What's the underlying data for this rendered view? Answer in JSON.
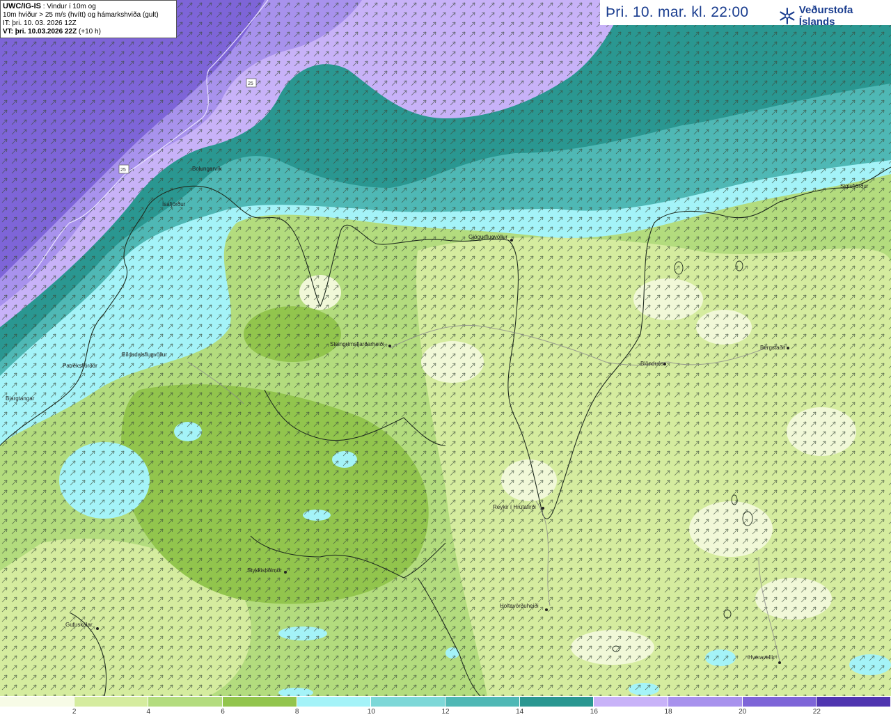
{
  "info": {
    "model": "UWC/IG-IS",
    "line1_rest": " : Vindur í 10m og",
    "line2": "10m hviður > 25 m/s (hvítt) og hámarkshviða (gult)",
    "line3": "IT: þri. 10. 03. 2026 12Z",
    "vt_label": "VT: þri. 10.03.2026 22Z",
    "vt_offset": " (+10 h)"
  },
  "header": {
    "valid_time": "Þri. 10. mar. kl. 22:00",
    "brand": "Veðurstofa Íslands"
  },
  "places": [
    "Bolungarvík",
    "Ísafjörður",
    "Patreksfjörður",
    "Bíldudalsflugvöllur",
    "Bjargtangar",
    "Steingrímsfjarðarheiði",
    "Gjögurflugvöllur",
    "Blönduós",
    "Bergstaðir",
    "Siglufjörður",
    "Reykir í Hrútafirði",
    "Stykkishólmur",
    "Holtavörðuheiði",
    "Gufuskálar",
    "Hveravellir"
  ],
  "road_markers": [
    "25",
    "25"
  ],
  "legend": {
    "unit": "m/s",
    "ticks": [
      "2",
      "4",
      "6",
      "8",
      "10",
      "12",
      "14",
      "16",
      "18",
      "20",
      "22"
    ],
    "colors": [
      "#f7fbe6",
      "#d5ec9f",
      "#b3dc7e",
      "#92c54d",
      "#a4f3f8",
      "#7dd8d8",
      "#4fb8b5",
      "#2a9791",
      "#c8b2f8",
      "#a892ed",
      "#7e65d8",
      "#4f35b0"
    ]
  }
}
